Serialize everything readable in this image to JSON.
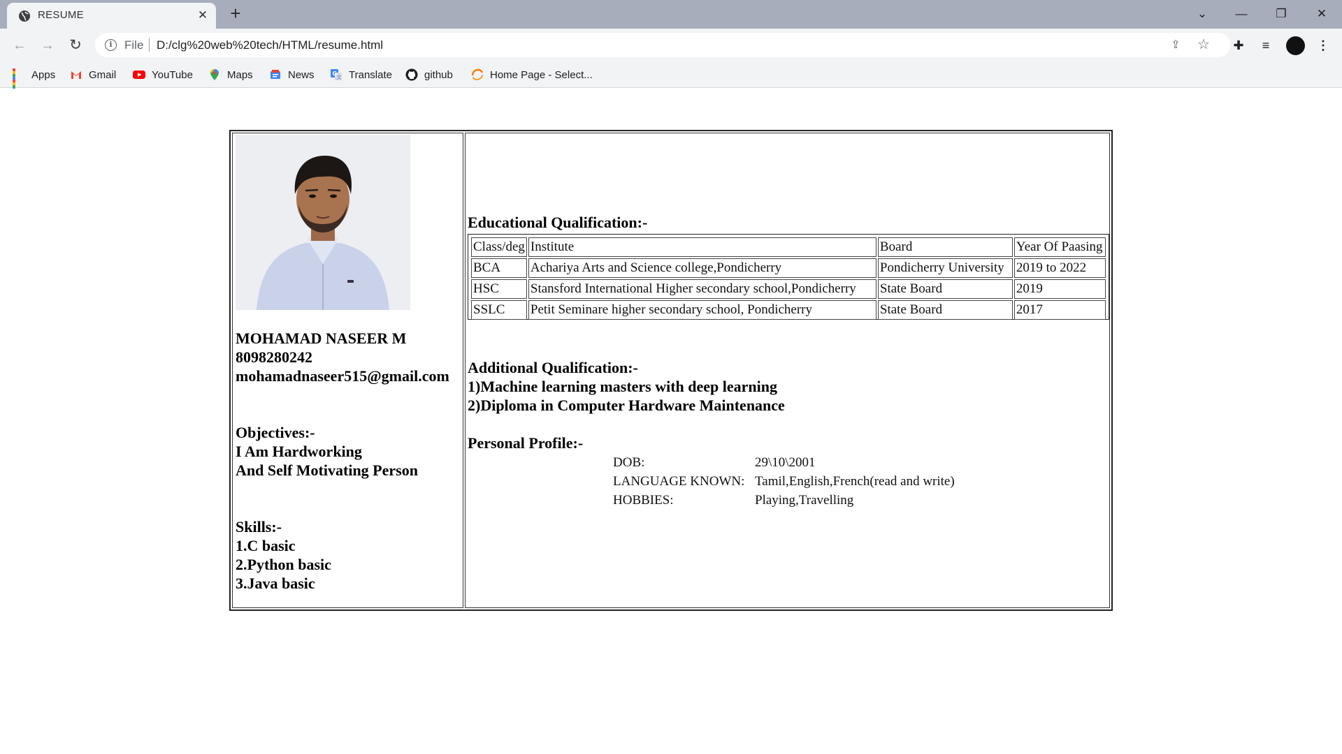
{
  "browser": {
    "tab_title": "RESUME",
    "scheme_label": "File",
    "url": "D:/clg%20web%20tech/HTML/resume.html",
    "bookmarks": [
      "Apps",
      "Gmail",
      "YouTube",
      "Maps",
      "News",
      "Translate",
      "github",
      "Home Page - Select..."
    ]
  },
  "resume": {
    "name": "MOHAMAD NASEER M",
    "phone": "8098280242",
    "email": "mohamadnaseer515@gmail.com",
    "objectives_heading": "Objectives:-",
    "objectives": [
      "I Am Hardworking",
      "And Self Motivating Person"
    ],
    "skills_heading": "Skills:-",
    "skills": [
      "1.C basic",
      "2.Python basic",
      "3.Java basic"
    ],
    "education_heading": "Educational Qualification:-",
    "education_table": {
      "headers": [
        "Class/deg",
        "Institute",
        "Board",
        "Year Of Paasing"
      ],
      "rows": [
        [
          "BCA",
          "Achariya Arts and Science college,Pondicherry",
          "Pondicherry University",
          "2019 to 2022"
        ],
        [
          "HSC",
          "Stansford International Higher secondary school,Pondicherry",
          "State Board",
          "2019"
        ],
        [
          "SSLC",
          "Petit Seminare higher secondary school, Pondicherry",
          "State Board",
          "2017"
        ]
      ]
    },
    "additional_heading": "Additional Qualification:-",
    "additional": [
      "1)Machine learning masters with deep learning",
      "2)Diploma in Computer Hardware Maintenance"
    ],
    "personal_heading": "Personal Profile:-",
    "personal": [
      {
        "label": "DOB:",
        "value": "29\\10\\2001"
      },
      {
        "label": "LANGUAGE KNOWN:",
        "value": "Tamil,English,French(read and write)"
      },
      {
        "label": "HOBBIES:",
        "value": "Playing,Travelling"
      }
    ]
  },
  "colors": {
    "tabstrip": "#a7adbb",
    "toolbar": "#f1f3f4",
    "gmail_red": "#ea4335",
    "youtube_red": "#ff0000",
    "maps_green": "#34a853",
    "translate_blue": "#4285f4",
    "home_orange": "#f57c00"
  },
  "icons": [
    "globe-icon",
    "close-icon",
    "plus-icon",
    "chevron-down-icon",
    "minimize-icon",
    "restore-icon",
    "back-arrow-icon",
    "forward-arrow-icon",
    "reload-icon",
    "info-icon",
    "share-icon",
    "star-icon",
    "extensions-icon",
    "reading-list-icon",
    "profile-avatar-icon",
    "kebab-menu-icon"
  ]
}
